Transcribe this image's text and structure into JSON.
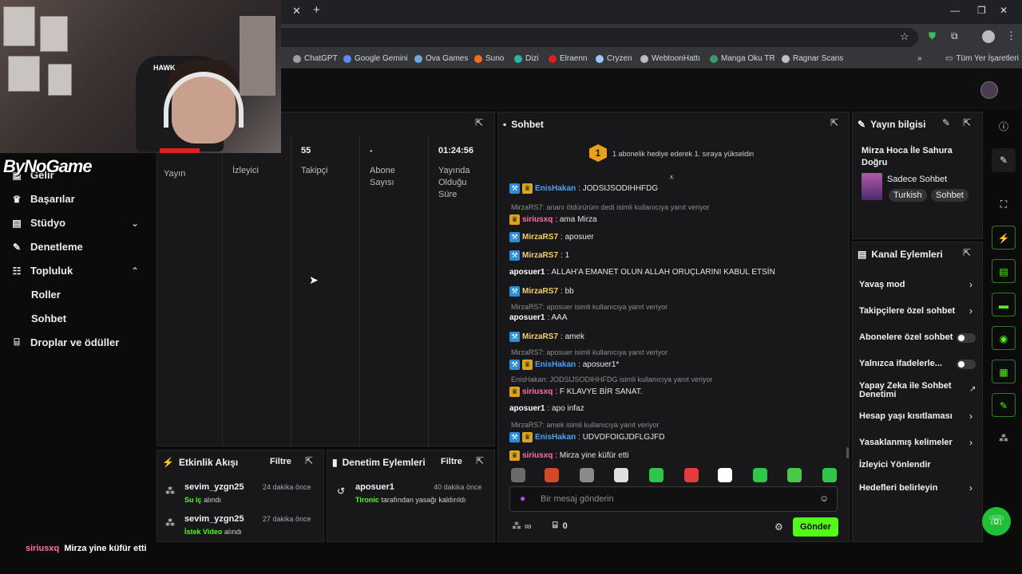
{
  "browser": {
    "tab_close": "✕",
    "new_tab": "+",
    "window": {
      "minimize": "—",
      "maximize": "❐",
      "close": "✕"
    },
    "bookmarks": [
      {
        "label": "ChatGPT",
        "color": "#9e9e9e"
      },
      {
        "label": "Google Gemini",
        "color": "#5b8def"
      },
      {
        "label": "Ova Games",
        "color": "#6fa8dc"
      },
      {
        "label": "Suno",
        "color": "#f26b1d"
      },
      {
        "label": "Dizi",
        "color": "#2bb3a3"
      },
      {
        "label": "Elraenn",
        "color": "#e02020"
      },
      {
        "label": "Cryzen",
        "color": "#a0c4ff"
      },
      {
        "label": "WebtoonHattı",
        "color": "#bbbbbb"
      },
      {
        "label": "Manga Oku TR",
        "color": "#3c9b6a"
      },
      {
        "label": "Ragnar Scans",
        "color": "#c0c0c0"
      }
    ],
    "all_bookmarks": "Tüm Yer İşaretleri",
    "more_bookmarks": "»"
  },
  "overlay": {
    "webcam_logo": "HAWK",
    "watermark": "ByNoGame",
    "bottom_user": "siriusxq",
    "bottom_text": "Mirza yine küfür etti"
  },
  "sidebar": {
    "items": [
      {
        "label": "Gelir",
        "icon": "money-icon"
      },
      {
        "label": "Başarılar",
        "icon": "trophy-icon"
      },
      {
        "label": "Stüdyo",
        "icon": "studio-icon"
      },
      {
        "label": "Denetleme",
        "icon": "wrench-icon"
      },
      {
        "label": "Topluluk",
        "icon": "community-icon"
      },
      {
        "label": "Droplar ve ödüller",
        "icon": "gift-icon"
      }
    ],
    "sub_items": [
      "Roller",
      "Sohbet"
    ]
  },
  "stats": {
    "columns": [
      {
        "value": "",
        "label": "Yayın"
      },
      {
        "value": "",
        "label": "İzleyici"
      },
      {
        "value": "55",
        "label": "Takipçi"
      },
      {
        "value": "-",
        "label": "Abone Sayısı"
      },
      {
        "value": "01:24:56",
        "label": "Yayında Olduğu Süre"
      }
    ]
  },
  "chat": {
    "title": "Sohbet",
    "pinned": "1 abonelik hediye ederek 1. sıraya yükseldin",
    "pinned_rank": "1",
    "input_placeholder": "Bir mesaj gönderin",
    "send_label": "Gönder",
    "points_label": "∞",
    "gift_count": "0",
    "messages": [
      {
        "type": "msg",
        "user": "EnisHakan",
        "text": ": JODSIJSODIHHFDG",
        "color": "#4aa3ff",
        "badges": [
          "b",
          "c"
        ]
      },
      {
        "type": "reply",
        "text": "MirzaRS7: ananı öldürürüm dedi isimli kullanıcıya yanıt veriyor"
      },
      {
        "type": "msg",
        "user": "siriusxq",
        "text": ": ama Mirza",
        "color": "#ff6fa8",
        "badges": [
          "c"
        ]
      },
      {
        "type": "msg",
        "user": "MirzaRS7",
        "text": ": aposuer",
        "color": "#f5d06b",
        "badges": [
          "b"
        ]
      },
      {
        "type": "msg",
        "user": "MirzaRS7",
        "text": ": 1",
        "color": "#f5d06b",
        "badges": [
          "b"
        ]
      },
      {
        "type": "msg",
        "user": "aposuer1",
        "text": ": ALLAH'A EMANET OLUN ALLAH ORUÇLARINI KABUL ETSİN",
        "color": "#ffffff",
        "badges": []
      },
      {
        "type": "msg",
        "user": "MirzaRS7",
        "text": ": bb",
        "color": "#f5d06b",
        "badges": [
          "b"
        ]
      },
      {
        "type": "reply",
        "text": "MirzaRS7: aposuer isimli kullanıcıya yanıt veriyor"
      },
      {
        "type": "msg",
        "user": "aposuer1",
        "text": ": AAA",
        "color": "#ffffff",
        "badges": []
      },
      {
        "type": "msg",
        "user": "MirzaRS7",
        "text": ": amek",
        "color": "#f5d06b",
        "badges": [
          "b"
        ]
      },
      {
        "type": "reply",
        "text": "MirzaRS7: aposuer isimli kullanıcıya yanıt veriyor"
      },
      {
        "type": "msg",
        "user": "EnisHakan",
        "text": ": aposuer1*",
        "color": "#4aa3ff",
        "badges": [
          "b",
          "c"
        ]
      },
      {
        "type": "reply",
        "text": "EnisHakan: JODSIJSODIHHFDG isimli kullanıcıya yanıt veriyor"
      },
      {
        "type": "msg",
        "user": "siriusxq",
        "text": ": F KLAVYE BİR SANAT.",
        "color": "#ff6fa8",
        "badges": [
          "c"
        ]
      },
      {
        "type": "msg",
        "user": "aposuer1",
        "text": ": apo infaz",
        "color": "#ffffff",
        "badges": []
      },
      {
        "type": "reply",
        "text": "MirzaRS7: amek isimli kullanıcıya yanıt veriyor"
      },
      {
        "type": "msg",
        "user": "EnisHakan",
        "text": ": UDVDFOIGJDFLGJFD",
        "color": "#4aa3ff",
        "badges": [
          "b",
          "c"
        ]
      },
      {
        "type": "msg",
        "user": "siriusxq",
        "text": ": Mirza yine küfür etti",
        "color": "#ff6fa8",
        "badges": [
          "c"
        ]
      }
    ]
  },
  "stream_info": {
    "title": "Yayın bilgisi",
    "stream_title": "Mirza Hoca İle Sahura Doğru",
    "category": "Sadece Sohbet",
    "tags": [
      "Turkish",
      "Sohbet"
    ]
  },
  "channel_actions": {
    "title": "Kanal Eylemleri",
    "items": [
      {
        "label": "Yavaş mod",
        "kind": "chevron"
      },
      {
        "label": "Takipçilere özel sohbet",
        "kind": "chevron"
      },
      {
        "label": "Abonelere özel sohbet",
        "kind": "toggle"
      },
      {
        "label": "Yalnızca ifadelerle...",
        "kind": "toggle"
      },
      {
        "label": "Yapay Zeka ile Sohbet Denetimi",
        "kind": "external"
      },
      {
        "label": "Hesap yaşı kısıtlaması",
        "kind": "chevron"
      },
      {
        "label": "Yasaklanmış kelimeler",
        "kind": "chevron"
      },
      {
        "label": "İzleyici Yönlendir",
        "kind": "none"
      },
      {
        "label": "Hedefleri belirleyin",
        "kind": "chevron"
      }
    ]
  },
  "activity": {
    "title": "Etkinlik Akışı",
    "filter": "Filtre",
    "events": [
      {
        "user": "sevim_yzgn25",
        "time": "24 dakika önce",
        "item": "Su iç",
        "suffix": " alındı"
      },
      {
        "user": "sevim_yzgn25",
        "time": "27 dakika önce",
        "item": "İstek Video",
        "suffix": " alındı"
      }
    ]
  },
  "moderation": {
    "title": "Denetim Eylemleri",
    "filter": "Filtre",
    "events": [
      {
        "user": "aposuer1",
        "time": "40 dakika önce",
        "actor": "Tironic",
        "suffix": " tarafından yasağı kaldırıldı"
      }
    ]
  },
  "colors": {
    "accent": "#53fc18",
    "panel": "#18181a",
    "bg": "#0b0b0c"
  }
}
